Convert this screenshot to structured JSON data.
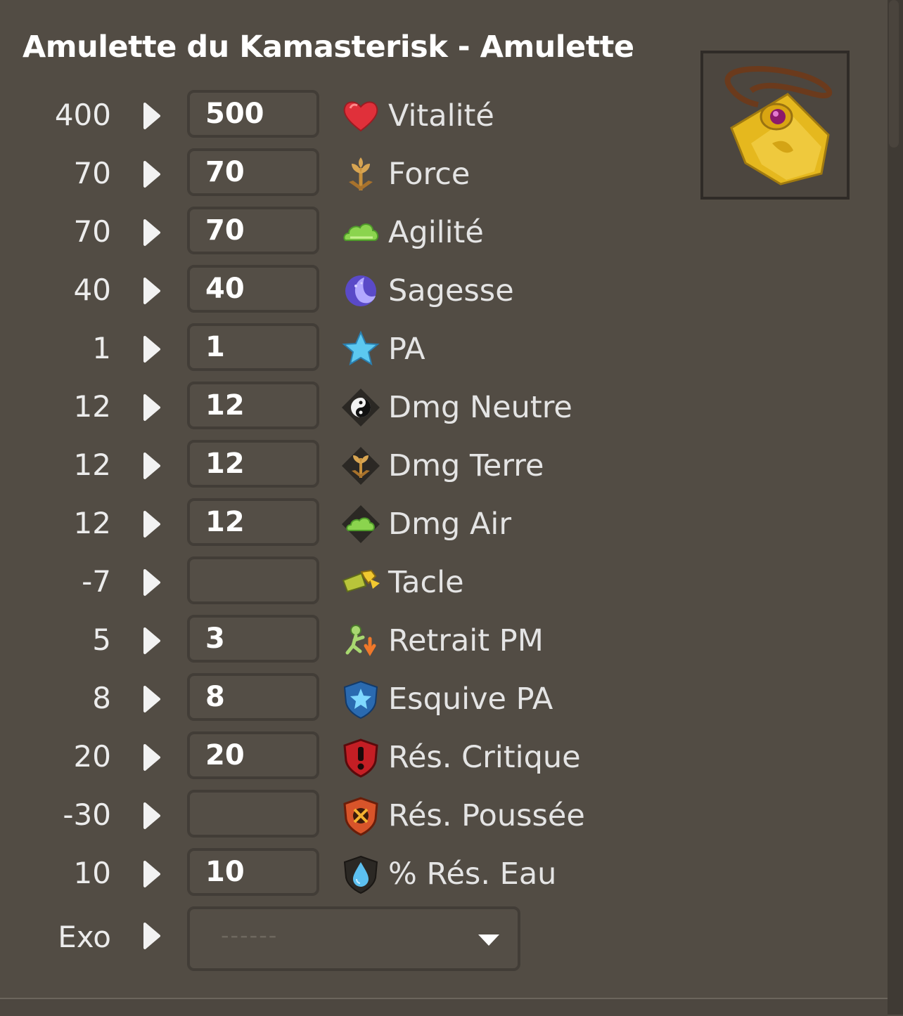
{
  "title": "Amulette du Kamasterisk - Amulette",
  "item_image": "amulet-icon",
  "stats": [
    {
      "base": "400",
      "value": "500",
      "label": "Vitalité",
      "icon": "heart-icon"
    },
    {
      "base": "70",
      "value": "70",
      "label": "Force",
      "icon": "earth-icon"
    },
    {
      "base": "70",
      "value": "70",
      "label": "Agilité",
      "icon": "air-icon"
    },
    {
      "base": "40",
      "value": "40",
      "label": "Sagesse",
      "icon": "moon-icon"
    },
    {
      "base": "1",
      "value": "1",
      "label": "PA",
      "icon": "star-icon"
    },
    {
      "base": "12",
      "value": "12",
      "label": "Dmg Neutre",
      "icon": "yin-yang-icon"
    },
    {
      "base": "12",
      "value": "12",
      "label": "Dmg Terre",
      "icon": "earth-damage-icon"
    },
    {
      "base": "12",
      "value": "12",
      "label": "Dmg Air",
      "icon": "air-damage-icon"
    },
    {
      "base": "-7",
      "value": "",
      "label": "Tacle",
      "icon": "tackle-icon"
    },
    {
      "base": "5",
      "value": "3",
      "label": "Retrait PM",
      "icon": "mp-reduction-icon"
    },
    {
      "base": "8",
      "value": "8",
      "label": "Esquive PA",
      "icon": "ap-dodge-shield-icon"
    },
    {
      "base": "20",
      "value": "20",
      "label": "Rés. Critique",
      "icon": "critical-resistance-icon"
    },
    {
      "base": "-30",
      "value": "",
      "label": "Rés. Poussée",
      "icon": "pushback-resistance-icon"
    },
    {
      "base": "10",
      "value": "10",
      "label": "% Rés. Eau",
      "icon": "water-resistance-icon"
    }
  ],
  "exo": {
    "label": "Exo",
    "placeholder": "------"
  }
}
